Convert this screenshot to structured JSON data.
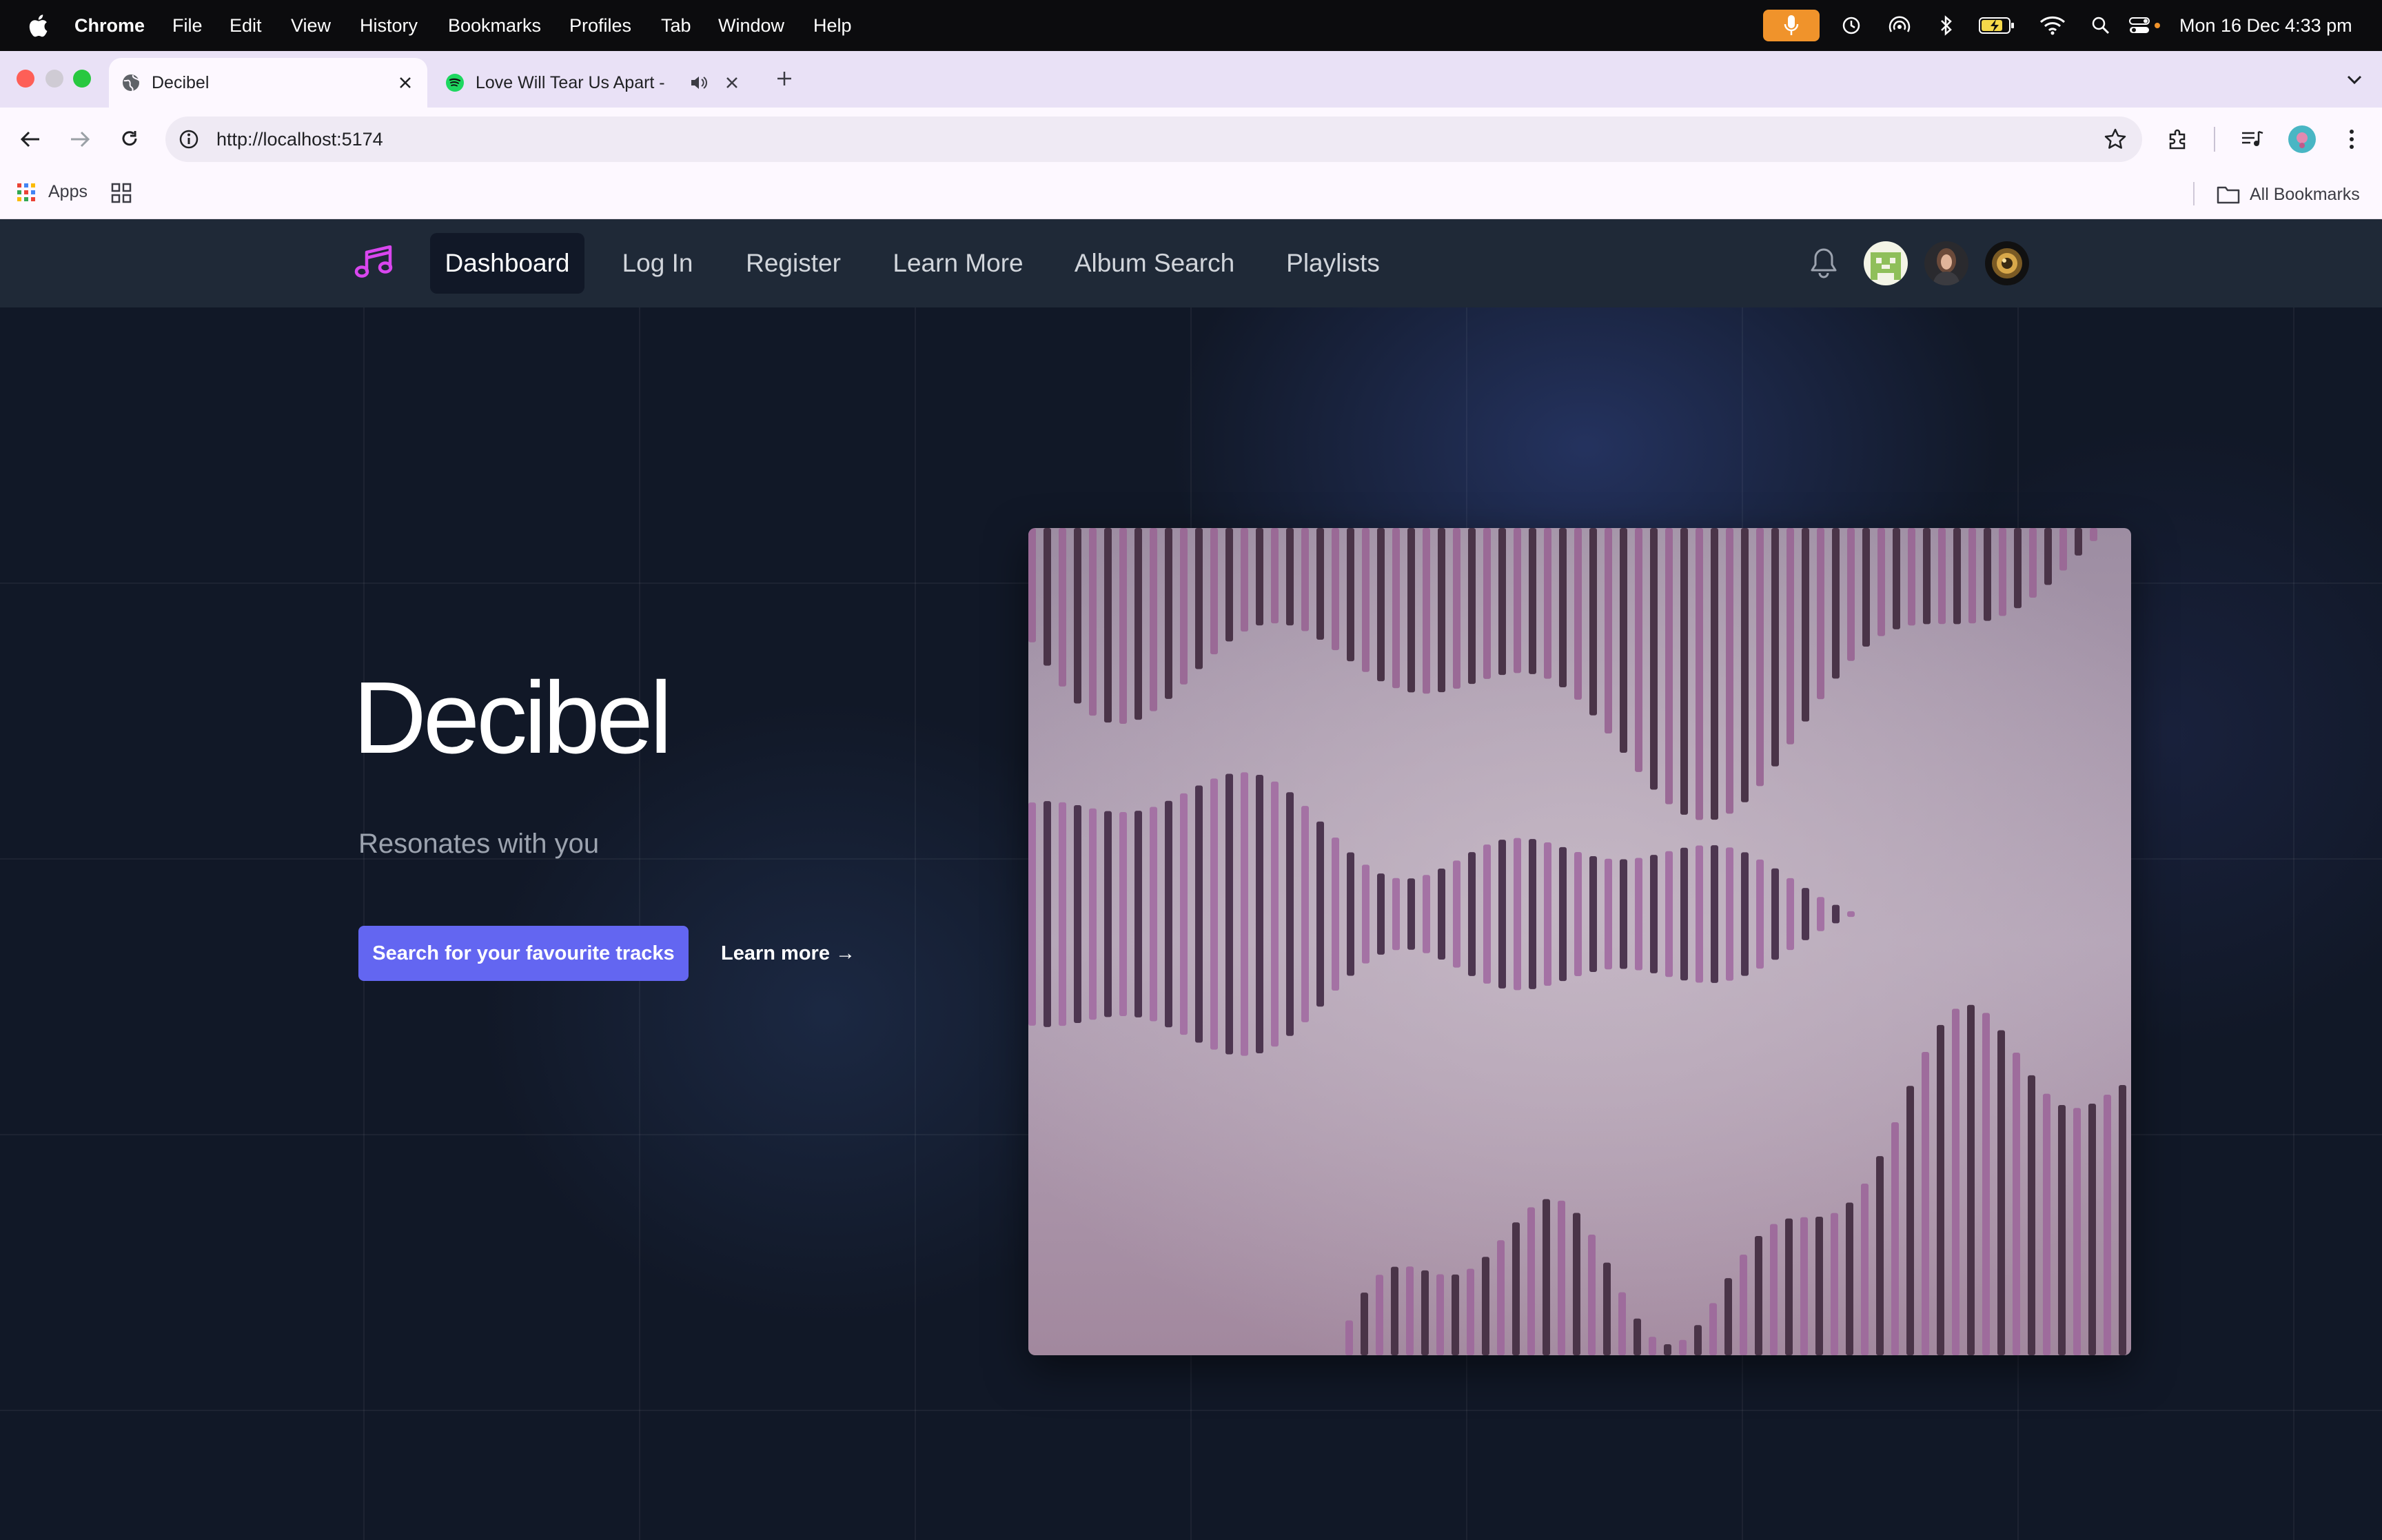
{
  "menubar": {
    "app_name": "Chrome",
    "items": [
      "File",
      "Edit",
      "View",
      "History",
      "Bookmarks",
      "Profiles",
      "Tab",
      "Window",
      "Help"
    ],
    "clock": "Mon 16 Dec  4:33 pm",
    "status_icons": [
      "microphone-icon",
      "time-machine-icon",
      "airdrop-icon",
      "bluetooth-icon",
      "battery-icon",
      "wifi-icon",
      "spotlight-icon",
      "control-center-icon"
    ]
  },
  "browser": {
    "tabs": [
      {
        "title": "Decibel",
        "active": true
      },
      {
        "title": "Love Will Tear Us Apart -",
        "active": false,
        "audio": true
      }
    ],
    "url": "http://localhost:5174",
    "bookmarks": {
      "apps_label": "Apps",
      "all_bookmarks_label": "All Bookmarks"
    }
  },
  "app": {
    "nav": {
      "items": [
        "Dashboard",
        "Log In",
        "Register",
        "Learn More",
        "Album Search",
        "Playlists"
      ],
      "active": "Dashboard"
    },
    "hero": {
      "title": "Decibel",
      "subtitle": "Resonates with you",
      "primary_cta": "Search for your favourite tracks",
      "secondary_cta": "Learn more →"
    },
    "colors": {
      "background": "#111827",
      "nav_background": "#1f2937",
      "accent": "#6366f1",
      "logo": "#d946ef",
      "art_base": "#a58ca8"
    }
  }
}
